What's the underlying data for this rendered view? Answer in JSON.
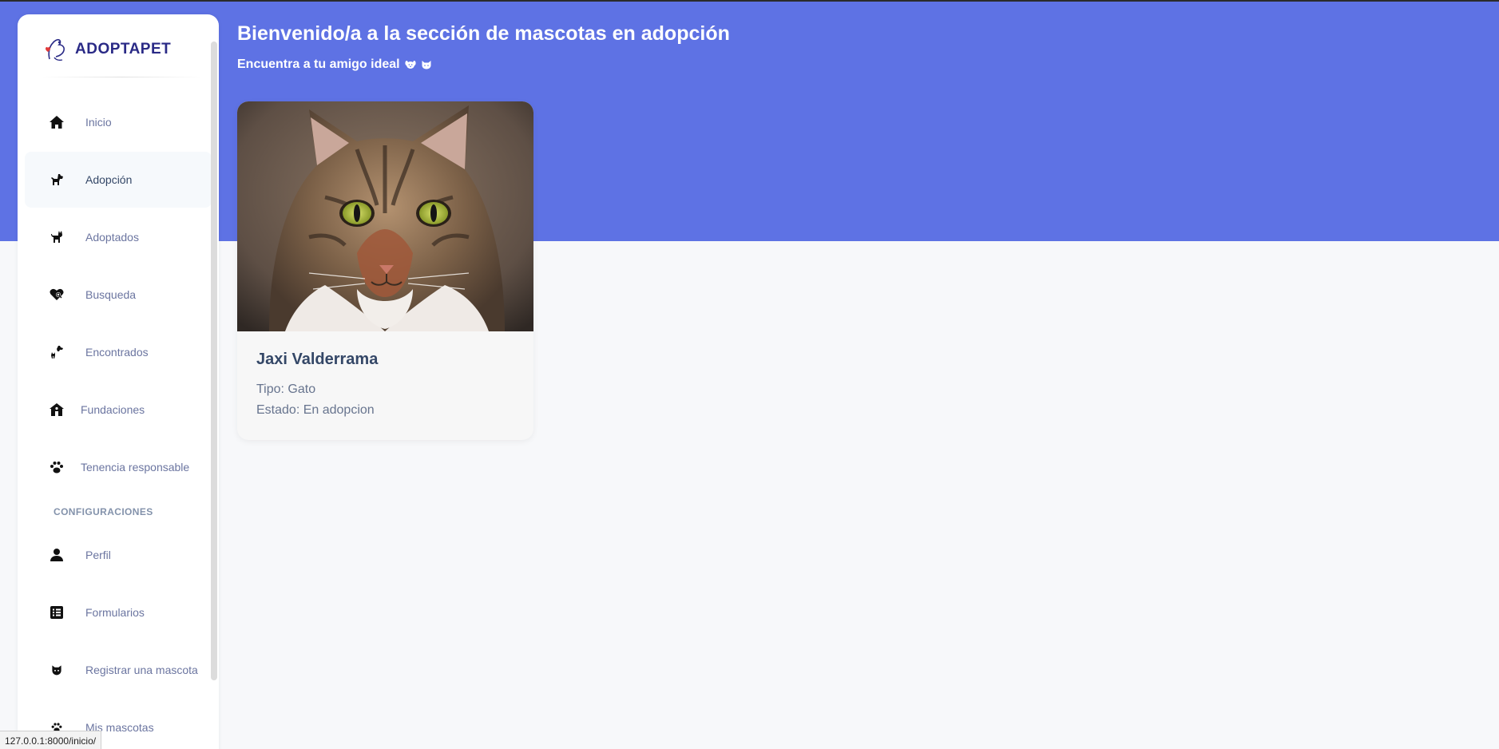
{
  "brand": {
    "name": "ADOPTAPET"
  },
  "colors": {
    "hero": "#5e72e4",
    "brand_text": "#2a2a86",
    "nav_text": "#6b75a0"
  },
  "sidebar": {
    "items": [
      {
        "label": "Inicio",
        "icon": "home-icon"
      },
      {
        "label": "Adopción",
        "icon": "dog-icon",
        "active": true
      },
      {
        "label": "Adoptados",
        "icon": "cat-icon"
      },
      {
        "label": "Busqueda",
        "icon": "heart-search-icon"
      },
      {
        "label": "Encontrados",
        "icon": "dog-cat-icon"
      },
      {
        "label": "Fundaciones",
        "icon": "shelter-house-icon"
      },
      {
        "label": "Tenencia responsable",
        "icon": "paw-icon"
      }
    ],
    "section_title": "CONFIGURACIONES",
    "config_items": [
      {
        "label": "Perfil",
        "icon": "user-icon"
      },
      {
        "label": "Formularios",
        "icon": "form-list-icon"
      },
      {
        "label": "Registrar una mascota",
        "icon": "cat-face-icon"
      },
      {
        "label": "Mis mascotas",
        "icon": "paw-icon"
      }
    ]
  },
  "header": {
    "title": "Bienvenido/a a la sección de mascotas en adopción",
    "subtitle": "Encuentra a tu amigo ideal"
  },
  "pets": [
    {
      "name": "Jaxi Valderrama",
      "tipo": "Tipo: Gato",
      "estado": "Estado: En adopcion"
    }
  ],
  "status_bar": {
    "url": "127.0.0.1:8000/inicio/"
  }
}
